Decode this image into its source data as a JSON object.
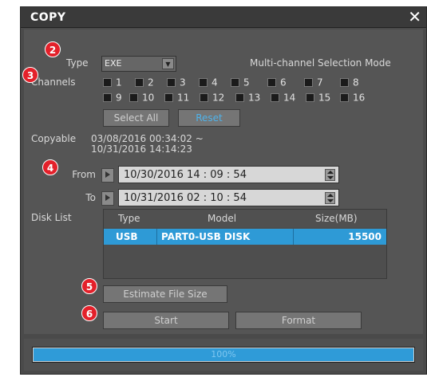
{
  "dialog": {
    "title": "COPY",
    "close_symbol": "✕"
  },
  "markers": [
    "2",
    "3",
    "4",
    "5",
    "6"
  ],
  "type": {
    "label": "Type",
    "value": "EXE",
    "arrow": "▼"
  },
  "mode_label": "Multi-channel Selection Mode",
  "channels": {
    "label": "Channels",
    "row1": [
      "1",
      "2",
      "3",
      "4",
      "5",
      "6",
      "7",
      "8"
    ],
    "row2": [
      "9",
      "10",
      "11",
      "12",
      "13",
      "14",
      "15",
      "16"
    ]
  },
  "buttons": {
    "select_all": "Select All",
    "reset": "Reset",
    "estimate": "Estimate File Size",
    "start": "Start",
    "format": "Format"
  },
  "copyable": {
    "label": "Copyable",
    "line1": "03/08/2016  00:34:02  ~",
    "line2": "10/31/2016  14:14:23"
  },
  "from": {
    "label": "From",
    "value": "10/30/2016  14 : 09 : 54"
  },
  "to": {
    "label": "To",
    "value": "10/31/2016  02 : 10 : 54"
  },
  "disk_list": {
    "label": "Disk List",
    "headers": [
      "Type",
      "Model",
      "Size(MB)"
    ],
    "rows": [
      {
        "type": "USB",
        "model": "PART0-USB DISK",
        "size": "15500"
      }
    ]
  },
  "progress": {
    "percent": 100,
    "label": "100%"
  },
  "colors": {
    "accent": "#2f9bd8",
    "marker": "#e4202a"
  }
}
